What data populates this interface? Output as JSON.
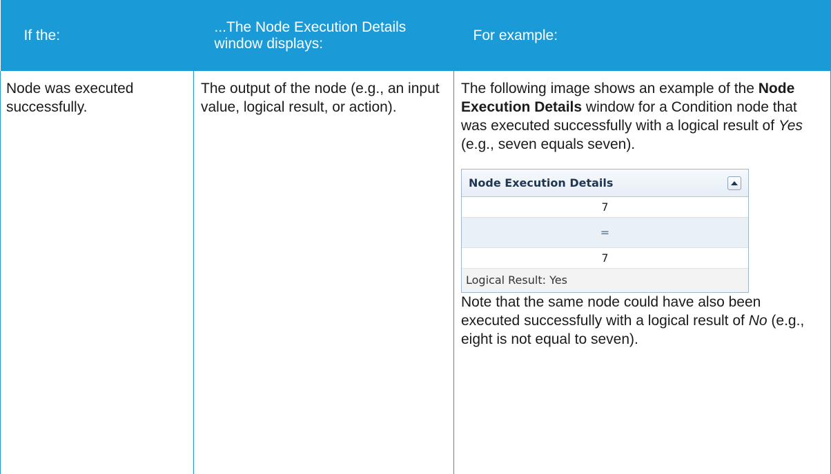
{
  "header": {
    "col1": "If the:",
    "col2": "...The Node Execution Details window displays:",
    "col3": "For example:"
  },
  "row": {
    "condition": "Node was executed successfully.",
    "displays": "The output of the node (e.g., an input value, logical result, or action).",
    "example": {
      "intro_1": "The following image shows an example of the ",
      "intro_bold": "Node Execution Details",
      "intro_2": " window for a Condition node that was executed successfully with a logical result of ",
      "intro_ital": "Yes",
      "intro_3": " (e.g., seven equals seven).",
      "note_1": "Note that the same node could have also been executed successfully with a logical result of ",
      "note_ital": "No",
      "note_2": " (e.g., eight is not equal to seven)."
    }
  },
  "widget": {
    "title": "Node Execution Details",
    "value_top": "7",
    "operator": "=",
    "value_bottom": "7",
    "footer": "Logical Result: Yes",
    "toggle_icon": "collapse-up-triangle"
  },
  "colors": {
    "header_bg": "#1b9ad8",
    "border": "#1b9ad8"
  }
}
